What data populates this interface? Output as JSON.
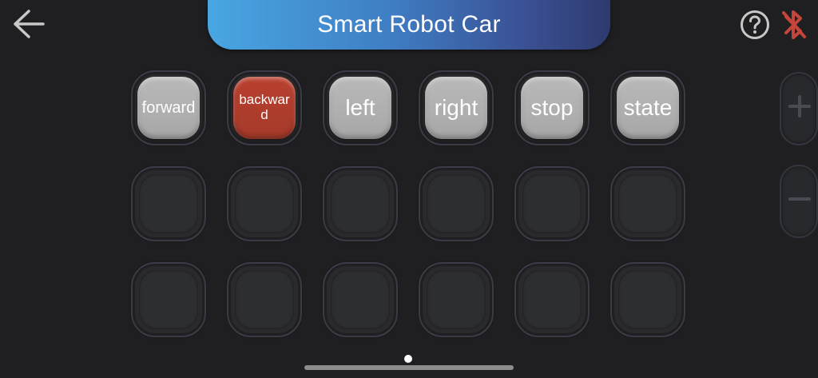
{
  "header": {
    "title": "Smart Robot Car",
    "back_icon": "arrow-left-icon",
    "help_icon": "question-circle-icon",
    "bluetooth_icon": "bluetooth-disconnected-icon"
  },
  "colors": {
    "background": "#1f1f21",
    "title_gradient_start": "#49a6e3",
    "title_gradient_end": "#2e3a6e",
    "key_default": "#b0b0b0",
    "key_active": "#ad3d2c",
    "bluetooth_off": "#c4453a"
  },
  "keys": [
    {
      "label": "forward",
      "active": false
    },
    {
      "label": "backwar d",
      "active": true
    },
    {
      "label": "left",
      "active": false
    },
    {
      "label": "right",
      "active": false
    },
    {
      "label": "stop",
      "active": false
    },
    {
      "label": "state",
      "active": false
    }
  ],
  "side_controls": {
    "zoom_in_icon": "plus-icon",
    "zoom_out_icon": "minus-icon"
  },
  "pagination": {
    "current_page": 1,
    "total_pages": 1
  }
}
